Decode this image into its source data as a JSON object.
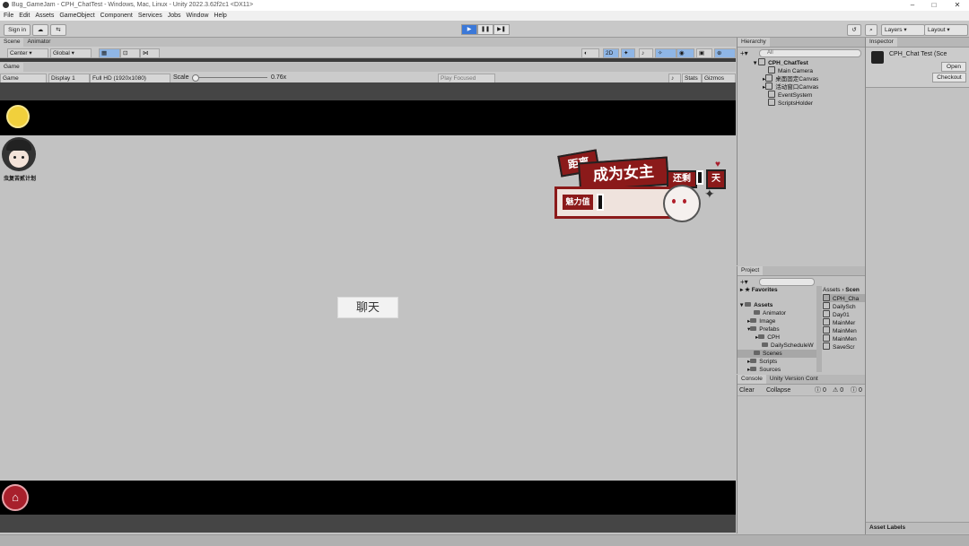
{
  "window": {
    "title": "Bug_GameJam - CPH_ChatTest - Windows, Mac, Linux - Unity 2022.3.62f2c1 <DX11>",
    "minimize": "–",
    "maximize": "□",
    "close": "✕"
  },
  "menu": [
    "File",
    "Edit",
    "Assets",
    "GameObject",
    "Component",
    "Services",
    "Jobs",
    "Window",
    "Help"
  ],
  "toolbar": {
    "sign_in": "Sign in",
    "layers": "Layers",
    "layout": "Layout"
  },
  "scene_tabs": [
    "Scene",
    "Animator"
  ],
  "scene_tools": {
    "pivot": "Center",
    "space": "Global"
  },
  "game_tab": "Game",
  "game_bar": {
    "view": "Game",
    "display": "Display 1",
    "resolution": "Full HD (1920x1080)",
    "scale_label": "Scale",
    "scale_value": "0.76x",
    "play_mode": "Play Focused",
    "stats": "Stats",
    "gizmos": "Gizmos"
  },
  "game": {
    "avatar_caption": "虫复苦贰计划",
    "banner_line1": "距离",
    "banner_line2": "成为女主",
    "banner_remain": "还剩",
    "banner_days_value": "",
    "banner_day_unit": "天",
    "charm_label": "魅力值",
    "charm_value": "",
    "chat_button": "聊天"
  },
  "hierarchy": {
    "tab": "Hierarchy",
    "search_placeholder": "All",
    "scene": "CPH_ChatTest",
    "items": [
      "Main Camera",
      "桌面固定Canvas",
      "活动窗口Canvas",
      "EventSystem",
      "ScriptsHolder"
    ]
  },
  "inspector": {
    "tab": "Inspector",
    "object_name": "CPH_Chat Test (Sce",
    "open": "Open",
    "checkout": "Checkout",
    "asset_labels": "Asset Labels"
  },
  "project": {
    "tab": "Project",
    "favorites": "Favorites",
    "assets": "Assets",
    "folders": [
      "Animator",
      "Image",
      "Prefabs",
      "CPH",
      "DailyScheduleW",
      "Scenes",
      "Scripts",
      "Sources"
    ],
    "breadcrumb_root": "Assets",
    "breadcrumb_sub": "Scen",
    "files": [
      "CPH_Cha",
      "DailySch",
      "Day01",
      "MainMer",
      "MainMen",
      "MainMen",
      "SaveScr"
    ]
  },
  "console": {
    "tab": "Console",
    "tab2": "Unity Version Cont",
    "clear": "Clear",
    "collapse": "Collapse",
    "count_info": "0",
    "count_warn": "0",
    "count_err": "0"
  },
  "colors": {
    "banner_red": "#8b1a1a",
    "banner_cream": "#efe3dd",
    "coin_yellow": "#f1d03c",
    "home_red": "#a8202c",
    "play_blue": "#3b78d8"
  }
}
